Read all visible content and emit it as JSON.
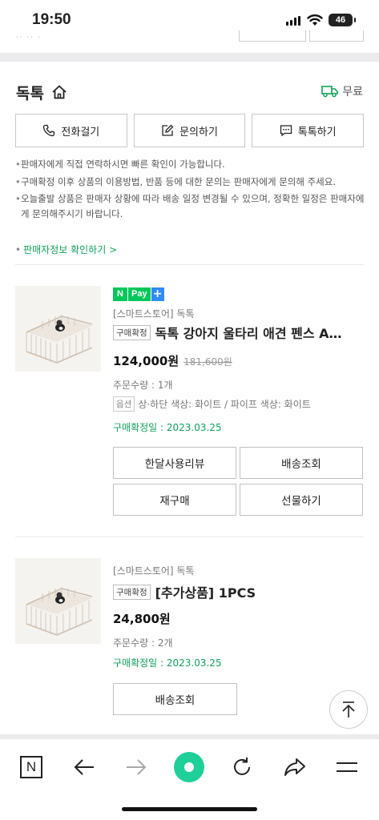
{
  "status": {
    "time": "19:50",
    "battery": "46"
  },
  "store": {
    "name": "독톡",
    "shipping_label": "무료"
  },
  "actions": {
    "call": "전화걸기",
    "inquiry": "문의하기",
    "talk": "톡톡하기"
  },
  "notes": [
    "판매자에게 직접 연락하시면 빠른 확인이 가능합니다.",
    "구매확정 이후 상품의 이용방법, 반품 등에 대한 문의는 판매자에게 문의해 주세요.",
    "오늘출발 상품은 판매자 상황에 따라 배송 일정 변경될 수 있으며, 정확한 일정은 판매자에게 문의해주시기 바랍니다."
  ],
  "seller_info_link": "판매자정보 확인하기 >",
  "orders": [
    {
      "npay": {
        "n": "N",
        "pay": "Pay",
        "plus": "+"
      },
      "store_tag": "[스마트스토어] 독톡",
      "badge": "구매확정",
      "title": "독톡 강아지 울타리 애견 펜스 A…",
      "price": "124,000원",
      "old_price": "181,600원",
      "quantity": "주문수량 : 1개",
      "option_badge": "옵션",
      "option_text": "상·하단 색상: 화이트 / 파이프 색상: 화이트",
      "confirm_date": "구매확정일 : 2023.03.25",
      "buttons": [
        "한달사용리뷰",
        "배송조회",
        "재구매",
        "선물하기"
      ]
    },
    {
      "store_tag": "[스마트스토어] 독톡",
      "badge": "구매확정",
      "title": "[추가상품] 1PCS",
      "price": "24,800원",
      "quantity": "주문수량 : 2개",
      "confirm_date": "구매확정일 : 2023.03.25",
      "buttons": [
        "배송조회"
      ]
    }
  ],
  "toolbar": {
    "n_label": "N"
  },
  "colors": {
    "green": "#10a15a",
    "npay_green": "#03c75a",
    "npay_blue": "#2e8cff",
    "center_button": "#1fcf9a"
  }
}
